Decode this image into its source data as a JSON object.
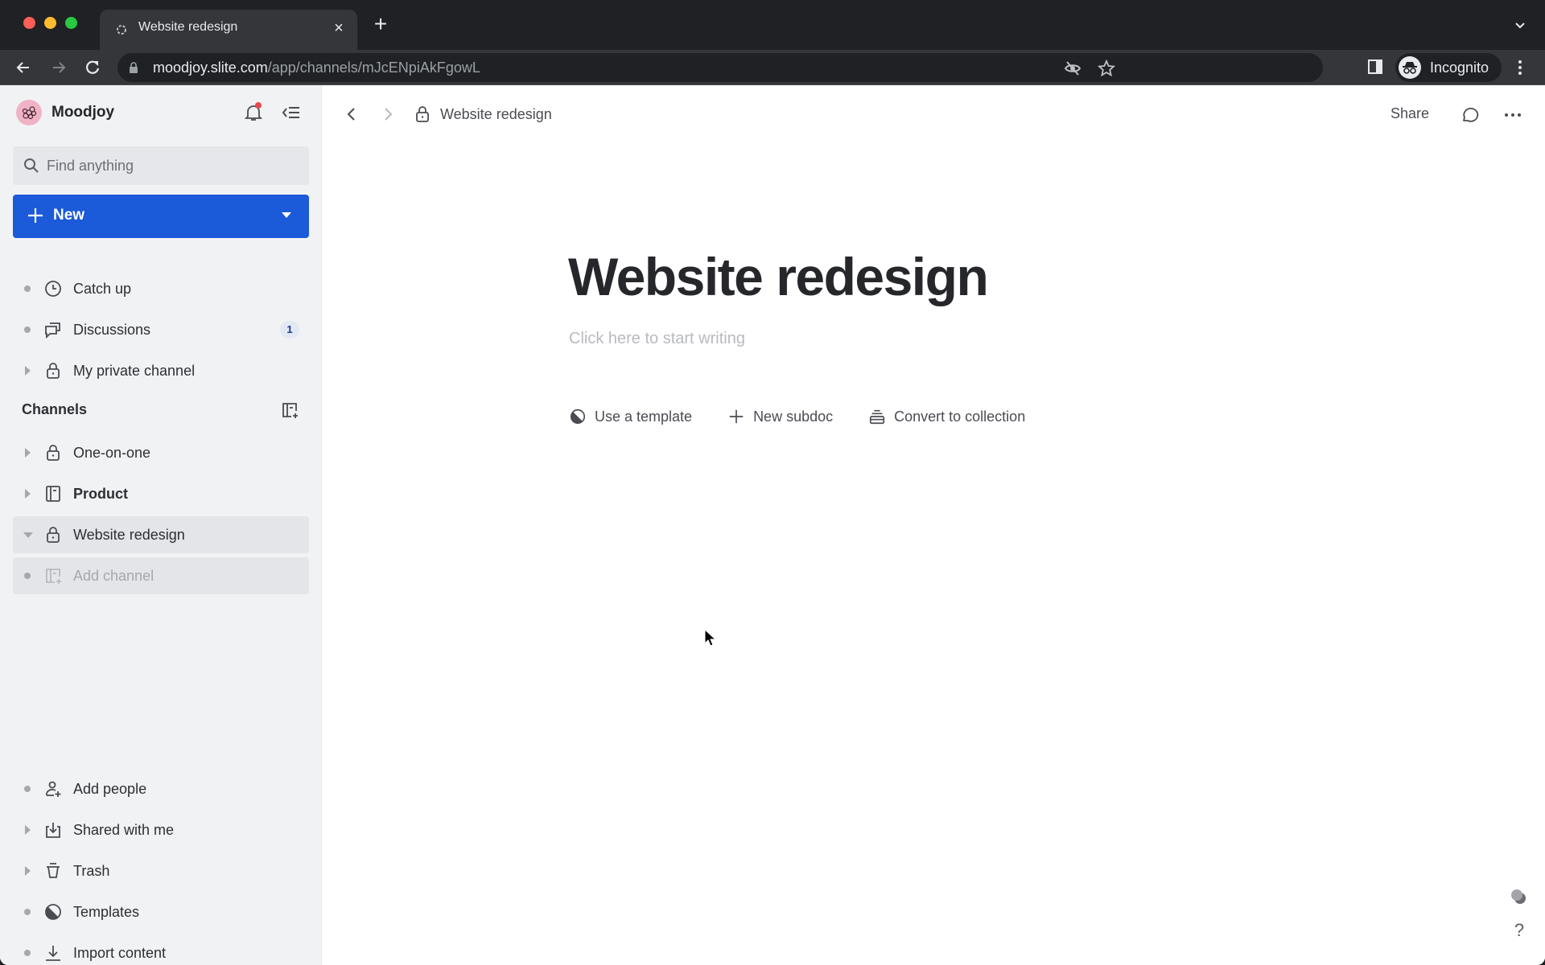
{
  "browser": {
    "tab_title": "Website redesign",
    "url_host": "moodjoy.slite.com",
    "url_path": "/app/channels/mJcENpiAkFgowL",
    "profile_label": "Incognito"
  },
  "sidebar": {
    "workspace_name": "Moodjoy",
    "search_placeholder": "Find anything",
    "new_button_label": "New",
    "top_items": [
      {
        "label": "Catch up",
        "icon": "clock-icon"
      },
      {
        "label": "Discussions",
        "icon": "chat-bubbles-icon",
        "badge": "1"
      },
      {
        "label": "My private channel",
        "icon": "lock-icon"
      }
    ],
    "channels_header": "Channels",
    "channels": [
      {
        "label": "One-on-one",
        "icon": "lock-icon"
      },
      {
        "label": "Product",
        "icon": "channel-icon"
      },
      {
        "label": "Website redesign",
        "icon": "lock-icon",
        "selected": true
      },
      {
        "label": "Add channel",
        "icon": "add-channel-icon"
      }
    ],
    "bottom_items": [
      {
        "label": "Add people",
        "icon": "add-user-icon"
      },
      {
        "label": "Shared with me",
        "icon": "inbox-download-icon"
      },
      {
        "label": "Trash",
        "icon": "trash-icon"
      },
      {
        "label": "Templates",
        "icon": "template-icon"
      },
      {
        "label": "Import content",
        "icon": "import-icon"
      }
    ]
  },
  "doc": {
    "breadcrumb_title": "Website redesign",
    "share_label": "Share",
    "title": "Website redesign",
    "placeholder": "Click here to start writing",
    "actions": [
      {
        "label": "Use a template",
        "icon": "template-icon"
      },
      {
        "label": "New subdoc",
        "icon": "plus-icon"
      },
      {
        "label": "Convert to collection",
        "icon": "collection-icon"
      }
    ]
  },
  "colors": {
    "accent": "#1b5ad8",
    "notification_dot": "#e5484d",
    "sidebar_bg": "#f1f2f4"
  }
}
